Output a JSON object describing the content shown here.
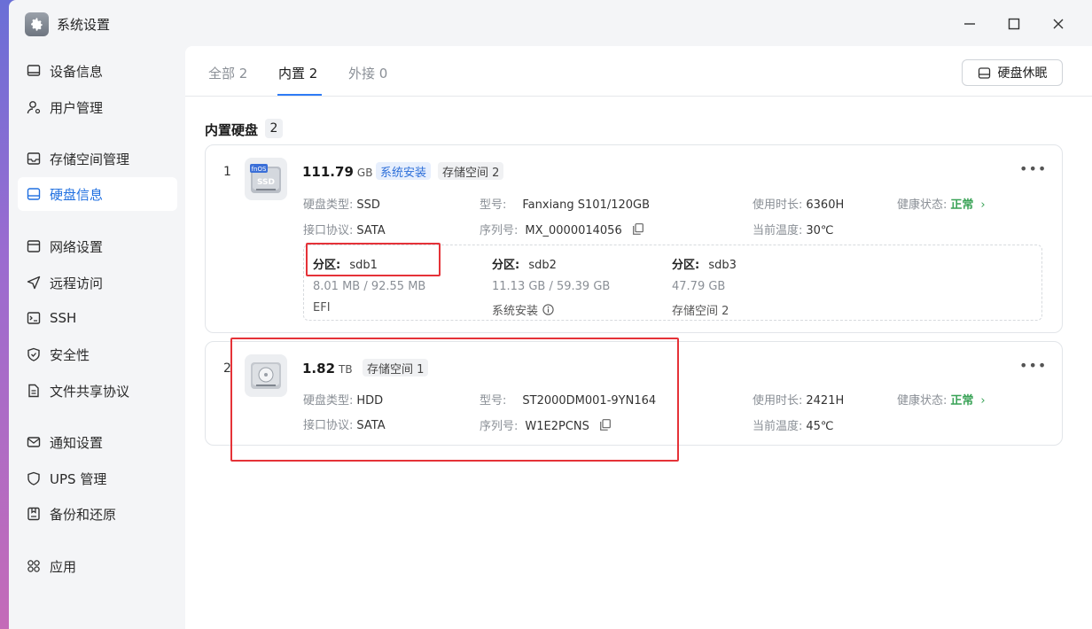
{
  "window": {
    "title": "系统设置"
  },
  "sidebar": {
    "items": [
      {
        "label": "设备信息",
        "icon": "monitor-icon"
      },
      {
        "label": "用户管理",
        "icon": "user-icon"
      },
      {
        "label": "存储空间管理",
        "icon": "storage-icon"
      },
      {
        "label": "硬盘信息",
        "icon": "disk-icon",
        "active": true
      },
      {
        "label": "网络设置",
        "icon": "network-icon"
      },
      {
        "label": "远程访问",
        "icon": "send-icon"
      },
      {
        "label": "SSH",
        "icon": "terminal-icon"
      },
      {
        "label": "安全性",
        "icon": "shield-check-icon"
      },
      {
        "label": "文件共享协议",
        "icon": "file-icon"
      },
      {
        "label": "通知设置",
        "icon": "mail-icon"
      },
      {
        "label": "UPS 管理",
        "icon": "ups-shield-icon"
      },
      {
        "label": "备份和还原",
        "icon": "backup-icon"
      },
      {
        "label": "应用",
        "icon": "apps-icon"
      }
    ]
  },
  "tabs": [
    {
      "label": "全部 2"
    },
    {
      "label": "内置 2",
      "active": true
    },
    {
      "label": "外接 0"
    }
  ],
  "toolbar": {
    "sleep_label": "硬盘休眠"
  },
  "section": {
    "title": "内置硬盘",
    "count": "2"
  },
  "disks": [
    {
      "index": "1",
      "icon_label": "fnOS",
      "icon_text": "SSD",
      "capacity": "111.79",
      "unit": "GB",
      "tags": [
        "系统安装",
        "存储空间 2"
      ],
      "type_label": "硬盘类型:",
      "type": "SSD",
      "interface_label": "接口协议:",
      "interface": "SATA",
      "model_label": "型号:",
      "model": "Fanxiang S101/120GB",
      "serial_label": "序列号:",
      "serial": "MX_0000014056",
      "hours_label": "使用时长:",
      "hours": "6360H",
      "temp_label": "当前温度:",
      "temp": "30℃",
      "health_label": "健康状态:",
      "health": "正常",
      "partitions": [
        {
          "title": "分区:",
          "name": "sdb1",
          "size": "8.01 MB / 92.55 MB",
          "usage": "EFI"
        },
        {
          "title": "分区:",
          "name": "sdb2",
          "size": "11.13 GB / 59.39 GB",
          "usage": "系统安装"
        },
        {
          "title": "分区:",
          "name": "sdb3",
          "size": "47.79 GB",
          "usage": "存储空间 2"
        }
      ]
    },
    {
      "index": "2",
      "capacity": "1.82",
      "unit": "TB",
      "tags": [
        "存储空间 1"
      ],
      "type_label": "硬盘类型:",
      "type": "HDD",
      "interface_label": "接口协议:",
      "interface": "SATA",
      "model_label": "型号:",
      "model": "ST2000DM001-9YN164",
      "serial_label": "序列号:",
      "serial": "W1E2PCNS",
      "hours_label": "使用时长:",
      "hours": "2421H",
      "temp_label": "当前温度:",
      "temp": "45℃",
      "health_label": "健康状态:",
      "health": "正常"
    }
  ],
  "colors": {
    "accent": "#2f7cf6",
    "healthy": "#3aa357",
    "highlight": "#e53238"
  }
}
